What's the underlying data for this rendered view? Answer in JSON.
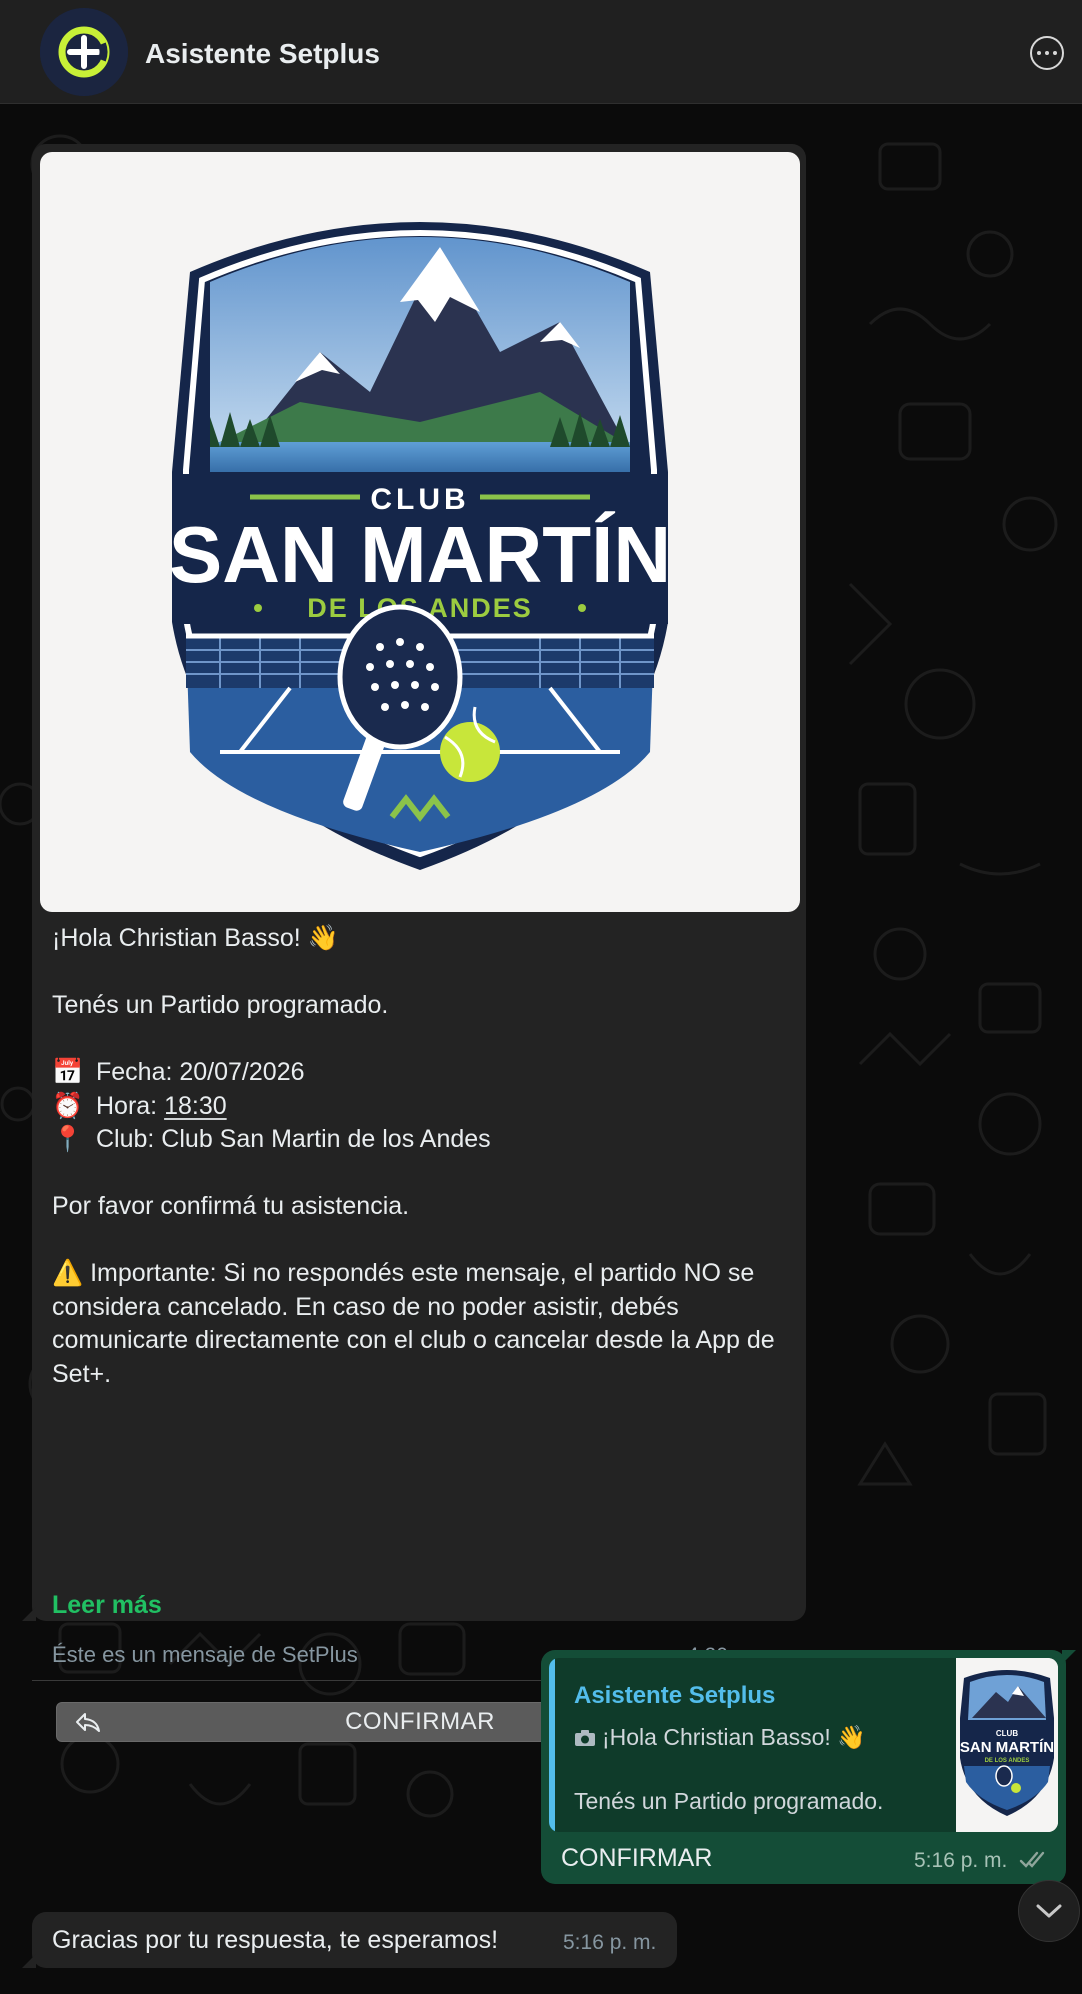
{
  "header": {
    "title": "Asistente Setplus",
    "avatar_icon": "setplus-logo-icon",
    "menu_icon": "more-options-icon"
  },
  "template_message": {
    "image": {
      "icon": "club-crest-logo",
      "text_line1": "CLUB",
      "text_line2": "SAN MARTÍN",
      "text_line3": "DE LOS ANDES"
    },
    "greeting": "¡Hola Christian Basso! 👋",
    "intro": "Tenés un Partido programado.",
    "fecha_emoji": "📅",
    "fecha": "Fecha: 20/07/2026",
    "hora_emoji": "⏰",
    "hora_label": "Hora: ",
    "hora_value": "18:30",
    "club_emoji": "📍",
    "club": "Club: Club San Martin de los Andes",
    "confirm_request": "Por favor confirmá tu asistencia.",
    "warning_emoji": "⚠️",
    "warning_text": "Importante: Si no respondés este mensaje, el partido NO se considera cancelado. En caso de no poder asistir, debés comunicarte directamente con el club o cancelar desde la App de Set+.",
    "read_more": "Leer más",
    "footer": "Éste es un mensaje de SetPlus",
    "time": "4:20 p. m.",
    "button_label": "CONFIRMAR"
  },
  "reply_message": {
    "quote_author": "Asistente Setplus",
    "quote_line1": "¡Hola Christian Basso! 👋",
    "quote_line2": "Tenés un Partido programado.",
    "text": "CONFIRMAR",
    "time": "5:16 p. m.",
    "status": "read",
    "colors": {
      "quote_accent": "#53bdeb",
      "bubble": "#144d37"
    }
  },
  "final_message": {
    "text": "Gracias por tu respuesta, te esperamos!",
    "time": "5:16 p. m."
  },
  "scroll_button_icon": "chevron-down-icon",
  "colors": {
    "link_green": "#21c063",
    "incoming_bubble": "#232323",
    "header_bg": "#202020"
  }
}
